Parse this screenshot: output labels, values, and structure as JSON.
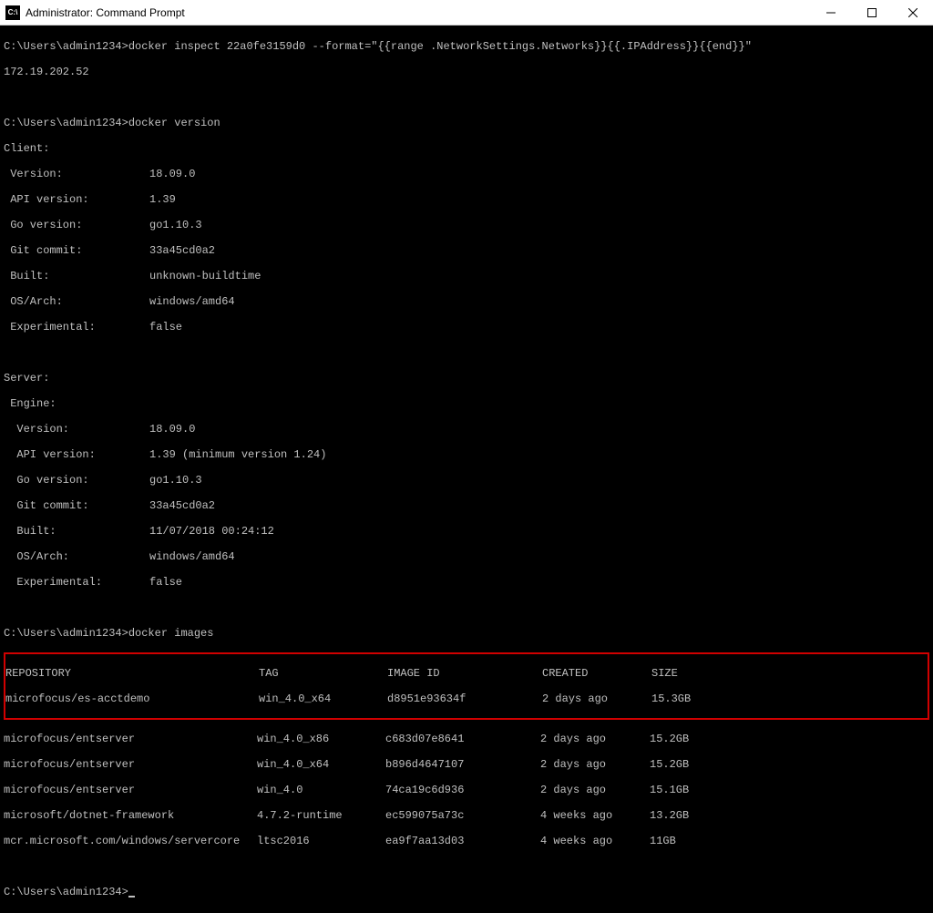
{
  "window": {
    "title": "Administrator: Command Prompt",
    "icon_label": "C:\\"
  },
  "prompt": "C:\\Users\\admin1234>",
  "cmd1": "docker inspect 22a0fe3159d0 --format=\"{{range .NetworkSettings.Networks}}{{.IPAddress}}{{end}}\"",
  "cmd1_output": "172.19.202.52",
  "cmd2": "docker version",
  "client_header": "Client:",
  "server_header": "Server:",
  "engine_header": " Engine:",
  "client": [
    {
      "k": " Version:",
      "v": "18.09.0"
    },
    {
      "k": " API version:",
      "v": "1.39"
    },
    {
      "k": " Go version:",
      "v": "go1.10.3"
    },
    {
      "k": " Git commit:",
      "v": "33a45cd0a2"
    },
    {
      "k": " Built:",
      "v": "unknown-buildtime"
    },
    {
      "k": " OS/Arch:",
      "v": "windows/amd64"
    },
    {
      "k": " Experimental:",
      "v": "false"
    }
  ],
  "server": [
    {
      "k": "  Version:",
      "v": "18.09.0"
    },
    {
      "k": "  API version:",
      "v": "1.39 (minimum version 1.24)"
    },
    {
      "k": "  Go version:",
      "v": "go1.10.3"
    },
    {
      "k": "  Git commit:",
      "v": "33a45cd0a2"
    },
    {
      "k": "  Built:",
      "v": "11/07/2018 00:24:12"
    },
    {
      "k": "  OS/Arch:",
      "v": "windows/amd64"
    },
    {
      "k": "  Experimental:",
      "v": "false"
    }
  ],
  "cmd3": "docker images",
  "images_header": {
    "repo": "REPOSITORY",
    "tag": "TAG",
    "id": "IMAGE ID",
    "created": "CREATED",
    "size": "SIZE"
  },
  "images": [
    {
      "repo": "microfocus/es-acctdemo",
      "tag": "win_4.0_x64",
      "id": "d8951e93634f",
      "created": "2 days ago",
      "size": "15.3GB",
      "highlight": true
    },
    {
      "repo": "microfocus/entserver",
      "tag": "win_4.0_x86",
      "id": "c683d07e8641",
      "created": "2 days ago",
      "size": "15.2GB"
    },
    {
      "repo": "microfocus/entserver",
      "tag": "win_4.0_x64",
      "id": "b896d4647107",
      "created": "2 days ago",
      "size": "15.2GB"
    },
    {
      "repo": "microfocus/entserver",
      "tag": "win_4.0",
      "id": "74ca19c6d936",
      "created": "2 days ago",
      "size": "15.1GB"
    },
    {
      "repo": "microsoft/dotnet-framework",
      "tag": "4.7.2-runtime",
      "id": "ec599075a73c",
      "created": "4 weeks ago",
      "size": "13.2GB"
    },
    {
      "repo": "mcr.microsoft.com/windows/servercore",
      "tag": "ltsc2016",
      "id": "ea9f7aa13d03",
      "created": "4 weeks ago",
      "size": "11GB"
    }
  ]
}
